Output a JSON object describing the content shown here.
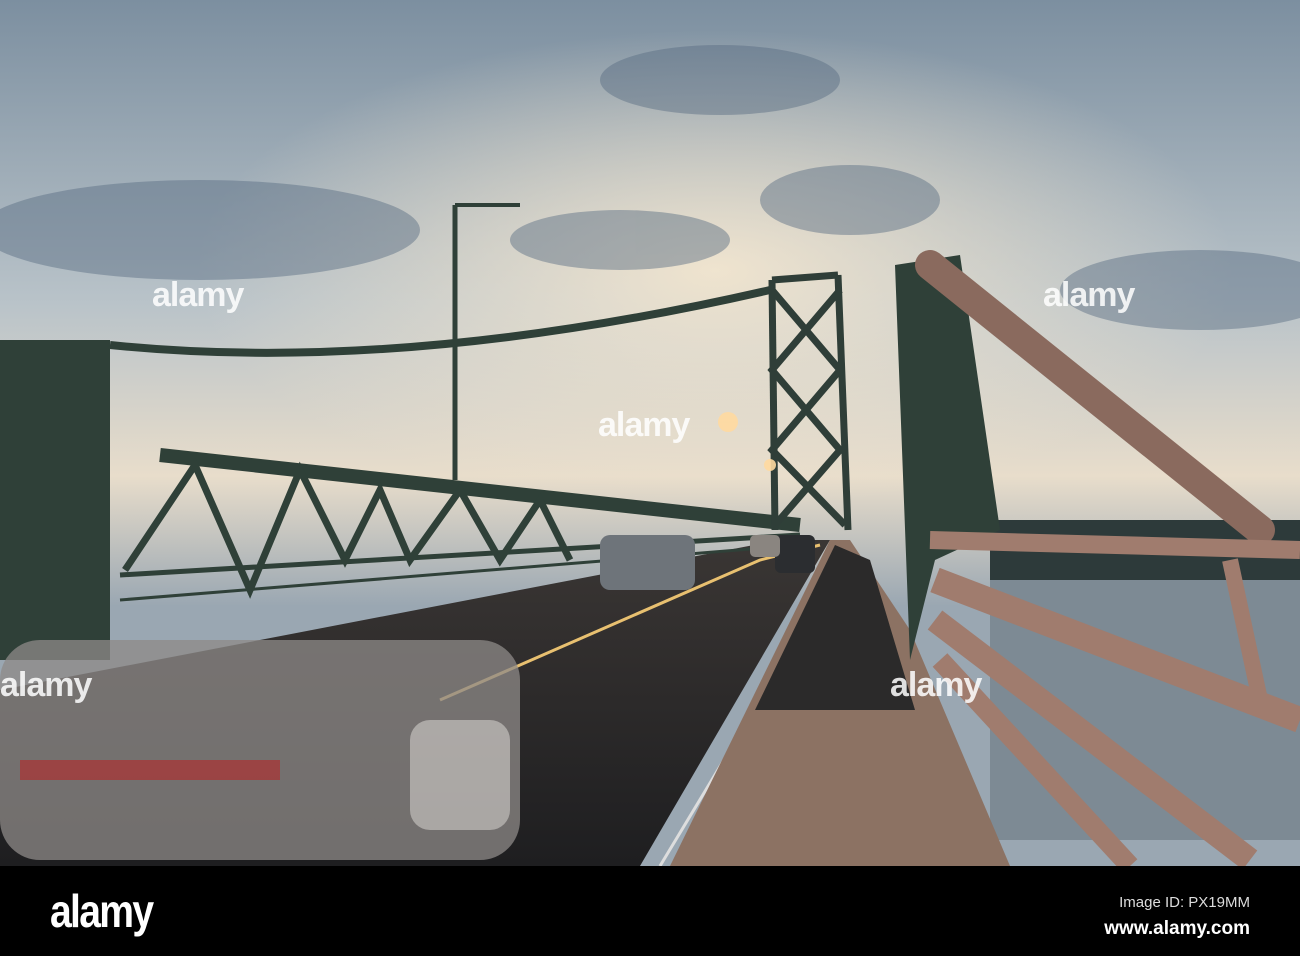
{
  "photo": {
    "watermark_text": "alamy",
    "colors": {
      "sky_top": "#6f8598",
      "sky_mid": "#c9cfd2",
      "sky_glow": "#efe2cc",
      "steel": "#2f4038",
      "road": "#2a2a2c",
      "walkway": "#8c7263",
      "rail": "#9c786a"
    }
  },
  "footer": {
    "logo": "alamy",
    "image_id": "Image ID: PX19MM",
    "website": "www.alamy.com"
  }
}
